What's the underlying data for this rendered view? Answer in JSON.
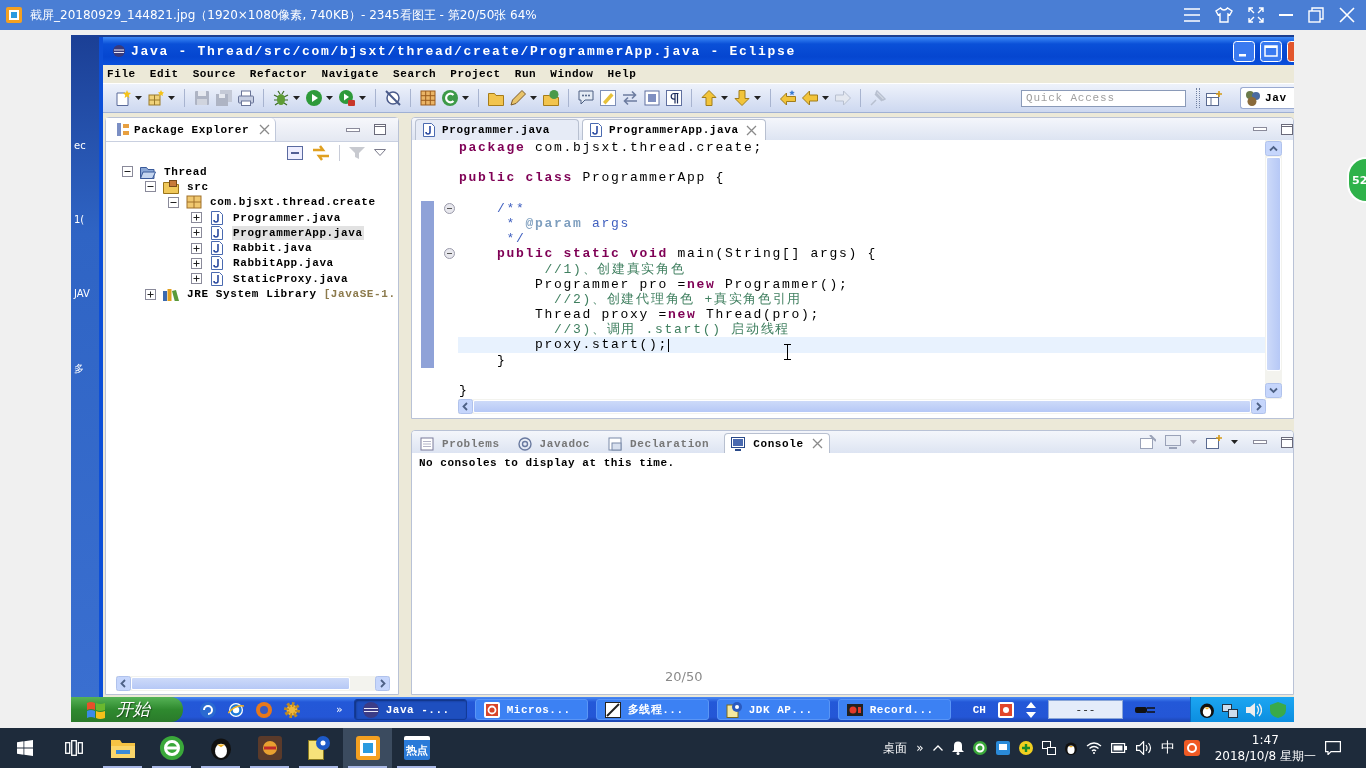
{
  "viewer": {
    "title": "截屏_20180929_144821.jpg（1920×1080像素, 740KB）- 2345看图王 - 第20/50张 64%",
    "page_counter": "20/50",
    "floating_ball": "52"
  },
  "desktop": {
    "icon_labels": [
      "ec",
      "1(",
      "JAV",
      "多"
    ]
  },
  "eclipse": {
    "title": "Java - Thread/src/com/bjsxt/thread/create/ProgrammerApp.java - Eclipse",
    "menu": [
      "File",
      "Edit",
      "Source",
      "Refactor",
      "Navigate",
      "Search",
      "Project",
      "Run",
      "Window",
      "Help"
    ],
    "quick_access": {
      "placeholder": "Quick Access"
    },
    "perspective": "Jav"
  },
  "package_explorer": {
    "title": "Package Explorer",
    "tree": [
      {
        "label": "Thread",
        "kind": "project",
        "expanded": true,
        "selected": false,
        "children": [
          {
            "label": "src",
            "kind": "source_folder",
            "expanded": true,
            "selected": false,
            "children": [
              {
                "label": "com.bjsxt.thread.create",
                "kind": "package",
                "expanded": true,
                "selected": false,
                "children": [
                  {
                    "label": "Programmer.java",
                    "kind": "java_file",
                    "expanded": false,
                    "selected": false
                  },
                  {
                    "label": "ProgrammerApp.java",
                    "kind": "java_file",
                    "expanded": false,
                    "selected": true
                  },
                  {
                    "label": "Rabbit.java",
                    "kind": "java_file",
                    "expanded": false,
                    "selected": false
                  },
                  {
                    "label": "RabbitApp.java",
                    "kind": "java_file",
                    "expanded": false,
                    "selected": false
                  },
                  {
                    "label": "StaticProxy.java",
                    "kind": "java_file",
                    "expanded": false,
                    "selected": false
                  }
                ]
              }
            ]
          },
          {
            "label": "JRE System Library",
            "decoration": "[JavaSE-1.",
            "kind": "library",
            "expanded": false,
            "selected": false
          }
        ]
      }
    ]
  },
  "editor": {
    "tabs": [
      {
        "label": "Programmer.java",
        "selected": false
      },
      {
        "label": "ProgrammerApp.java",
        "selected": true
      }
    ],
    "lines": [
      {
        "kind": "code",
        "tokens": [
          {
            "kind": "keyword",
            "text": "package"
          },
          {
            "kind": "plain",
            "text": " com.bjsxt.thread.create;"
          }
        ],
        "fold": false,
        "in_range": false,
        "current": false
      },
      {
        "kind": "blank"
      },
      {
        "kind": "code",
        "tokens": [
          {
            "kind": "keyword",
            "text": "public class"
          },
          {
            "kind": "plain",
            "text": " ProgrammerApp {"
          }
        ],
        "fold": false,
        "in_range": false,
        "current": false
      },
      {
        "kind": "blank"
      },
      {
        "kind": "code",
        "tokens": [
          {
            "kind": "javadoc",
            "text": "    /**"
          }
        ],
        "fold": true,
        "in_range": true,
        "current": false
      },
      {
        "kind": "code",
        "tokens": [
          {
            "kind": "javadoc",
            "text": "     * "
          },
          {
            "kind": "javadoc_tag",
            "text": "@param"
          },
          {
            "kind": "javadoc",
            "text": " args"
          }
        ],
        "fold": false,
        "in_range": true,
        "current": false
      },
      {
        "kind": "code",
        "tokens": [
          {
            "kind": "javadoc",
            "text": "     */"
          }
        ],
        "fold": false,
        "in_range": true,
        "current": false
      },
      {
        "kind": "code",
        "tokens": [
          {
            "kind": "keyword",
            "text": "    public static void"
          },
          {
            "kind": "plain",
            "text": " main(String[] args) {"
          }
        ],
        "fold": true,
        "in_range": true,
        "current": false
      },
      {
        "kind": "code",
        "tokens": [
          {
            "kind": "comment",
            "text": "         //1)、创建真实角色"
          }
        ],
        "fold": false,
        "in_range": true,
        "current": false
      },
      {
        "kind": "code",
        "tokens": [
          {
            "kind": "plain",
            "text": "        Programmer pro ="
          },
          {
            "kind": "keyword",
            "text": "new"
          },
          {
            "kind": "plain",
            "text": " Programmer();"
          }
        ],
        "fold": false,
        "in_range": true,
        "current": false
      },
      {
        "kind": "code",
        "tokens": [
          {
            "kind": "comment",
            "text": "          //2)、创建代理角色 +真实角色引用"
          }
        ],
        "fold": false,
        "in_range": true,
        "current": false
      },
      {
        "kind": "code",
        "tokens": [
          {
            "kind": "plain",
            "text": "        Thread proxy ="
          },
          {
            "kind": "keyword",
            "text": "new"
          },
          {
            "kind": "plain",
            "text": " Thread(pro);"
          }
        ],
        "fold": false,
        "in_range": true,
        "current": false
      },
      {
        "kind": "code",
        "tokens": [
          {
            "kind": "comment",
            "text": "          //3)、调用 .start() 启动线程"
          }
        ],
        "fold": false,
        "in_range": true,
        "current": false
      },
      {
        "kind": "code",
        "tokens": [
          {
            "kind": "plain",
            "text": "        proxy.start();"
          }
        ],
        "fold": false,
        "in_range": true,
        "current": true
      },
      {
        "kind": "code",
        "tokens": [
          {
            "kind": "plain",
            "text": "    }"
          }
        ],
        "fold": false,
        "in_range": true,
        "current": false
      },
      {
        "kind": "blank"
      },
      {
        "kind": "code",
        "tokens": [
          {
            "kind": "plain",
            "text": "}"
          }
        ],
        "fold": false,
        "in_range": false,
        "current": false
      }
    ]
  },
  "console_view": {
    "tabs": [
      {
        "label": "Problems",
        "kind": "problems",
        "selected": false
      },
      {
        "label": "Javadoc",
        "kind": "javadoc",
        "selected": false
      },
      {
        "label": "Declaration",
        "kind": "declaration",
        "selected": false
      },
      {
        "label": "Console",
        "kind": "console",
        "selected": true
      }
    ],
    "message": "No consoles to display at this time."
  },
  "xp_taskbar": {
    "start": "开始",
    "quick_launch_more": "»",
    "tasks": [
      {
        "label": "Java -...",
        "kind": "sphere",
        "selected": true
      },
      {
        "label": "Micros...",
        "kind": "document",
        "selected": false
      },
      {
        "label": "多线程...",
        "kind": "picture",
        "selected": false
      },
      {
        "label": "JDK AP...",
        "kind": "help",
        "selected": false
      },
      {
        "label": "Record...",
        "kind": "recorder",
        "selected": false
      }
    ],
    "language": "CH",
    "deskband": "---"
  },
  "win_taskbar": {
    "apps": [
      {
        "kind": "folder",
        "running": true,
        "selected": false
      },
      {
        "kind": "browser",
        "running": true,
        "selected": false
      },
      {
        "kind": "penguin",
        "running": true,
        "selected": false
      },
      {
        "kind": "game",
        "running": true,
        "selected": false
      },
      {
        "kind": "help",
        "running": true,
        "selected": false
      },
      {
        "kind": "viewer",
        "running": true,
        "selected": true
      },
      {
        "kind": "tile",
        "label": "热点",
        "running": true,
        "selected": false
      }
    ],
    "desktop_label": "桌面",
    "more": "»",
    "ime": "中",
    "time": "1:47",
    "date": "2018/10/8 星期一"
  }
}
